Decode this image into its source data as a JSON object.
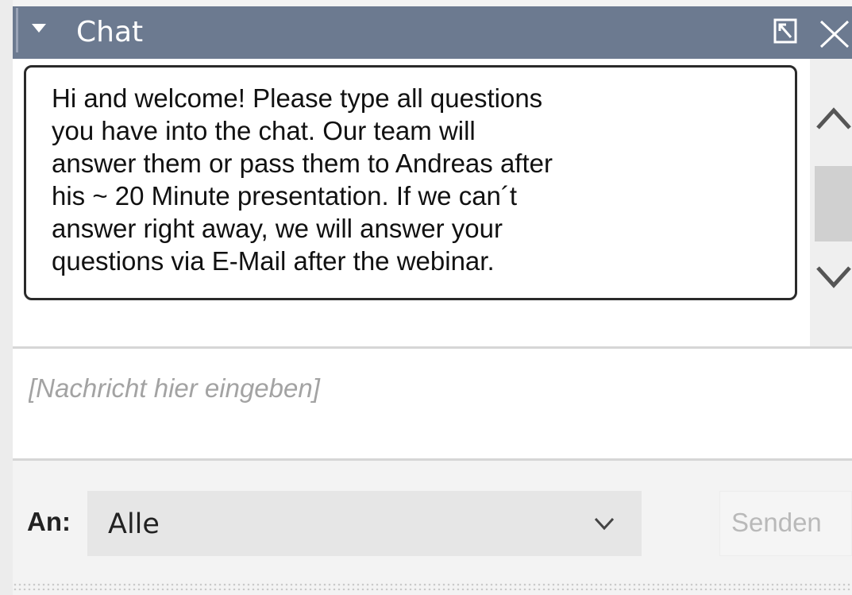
{
  "window": {
    "title": "Chat",
    "collapse_icon": "caret-down-icon",
    "undock_icon": "undock-icon",
    "close_icon": "close-icon",
    "header_color": "#6c7a90"
  },
  "messages": [
    {
      "text": "Hi and welcome! Please type all questions\nyou have into the chat. Our team will\nanswer them or pass them to Andreas after\nhis ~ 20 Minute presentation. If we can´t\nanswer right away, we will answer your\nquestions via E-Mail after the webinar."
    }
  ],
  "composer": {
    "placeholder": "[Nachricht hier eingeben]",
    "value": ""
  },
  "footer": {
    "to_label": "An:",
    "recipient_selected": "Alle",
    "send_label": "Senden"
  }
}
